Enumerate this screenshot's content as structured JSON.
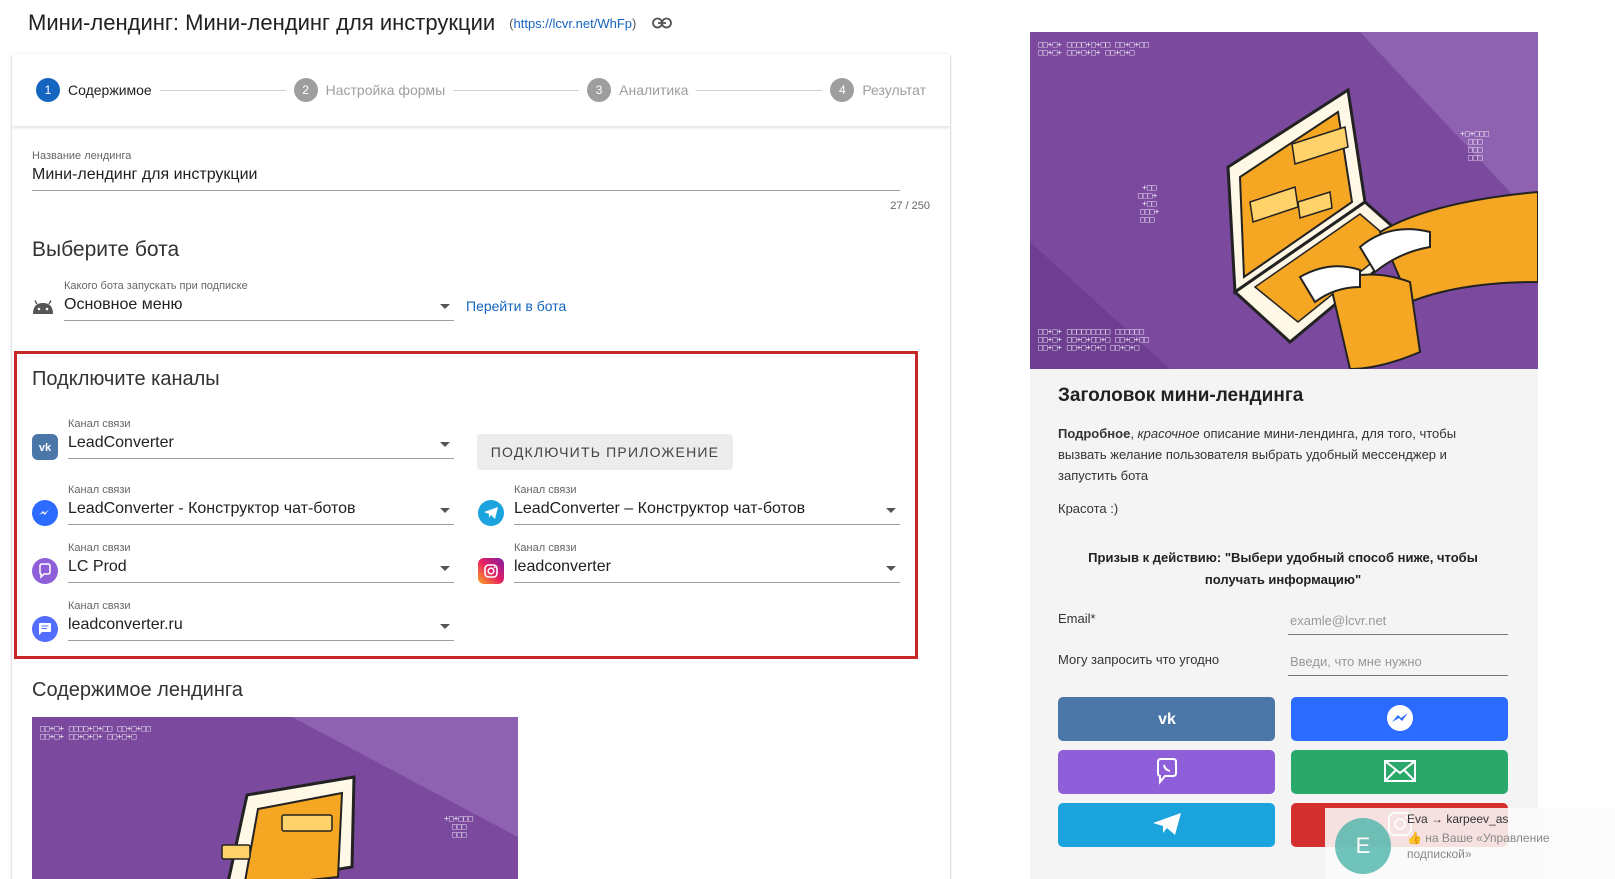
{
  "header": {
    "title": "Мини-лендинг: Мини-лендинг для инструкции",
    "link_open": "(",
    "link_url": "https://lcvr.net/WhFp",
    "link_close": ")"
  },
  "stepper": [
    {
      "num": "1",
      "label": "Содержимое"
    },
    {
      "num": "2",
      "label": "Настройка формы"
    },
    {
      "num": "3",
      "label": "Аналитика"
    },
    {
      "num": "4",
      "label": "Результат"
    }
  ],
  "name_field": {
    "label": "Название лендинга",
    "value": "Мини-лендинг для инструкции",
    "counter": "27 / 250"
  },
  "bot_section": {
    "title": "Выберите бота",
    "label": "Какого бота запускать при подписке",
    "value": "Основное меню",
    "go_link": "Перейти в бота"
  },
  "channels": {
    "title": "Подключите каналы",
    "connect_button": "ПОДКЛЮЧИТЬ ПРИЛОЖЕНИЕ",
    "items": [
      {
        "label": "Канал связи",
        "value": "LeadConverter",
        "icon": "vk-icon"
      },
      {
        "label": "Канал связи",
        "value": "LeadConverter - Конструктор чат-ботов",
        "icon": "messenger-icon"
      },
      {
        "label": "Канал связи",
        "value": "LeadConverter – Конструктор чат-ботов",
        "icon": "telegram-icon"
      },
      {
        "label": "Канал связи",
        "value": "LC Prod",
        "icon": "viber-icon"
      },
      {
        "label": "Канал связи",
        "value": "leadconverter",
        "icon": "instagram-icon"
      },
      {
        "label": "Канал связи",
        "value": "leadconverter.ru",
        "icon": "chat-icon"
      }
    ]
  },
  "content_section": {
    "title": "Содержимое лендинга"
  },
  "preview": {
    "title": "Заголовок мини-лендинга",
    "desc_bold": "Подробное",
    "desc_sep": ", ",
    "desc_italic": "красочное",
    "desc_rest": " описание мини-лендинга, для того, чтобы вызвать желание пользователя выбрать удобный мессенджер и запустить бота",
    "beauty": "Красота :)",
    "cta": "Призыв к действию: \"Выбери удобный способ ниже, чтобы получать информацию\"",
    "email_label": "Email*",
    "email_placeholder": "examle@lcvr.net",
    "ask_label": "Могу запросить что угодно",
    "ask_placeholder": "Введи, что мне нужно"
  },
  "toast": {
    "avatar_letter": "E",
    "sender": "Eva → karpeev_as",
    "message": "👍 на Ваше «Управление подпиской»"
  },
  "colors": {
    "accent": "#1565c0",
    "highlight_border": "#c62828",
    "vk": "#4a76a8",
    "messenger": "#2b6bff",
    "viber": "#8e5fd9",
    "email": "#2aa86a",
    "telegram": "#1aa3dc",
    "illustration_purple": "#7b4a9e",
    "illustration_yellow": "#f5a623"
  }
}
